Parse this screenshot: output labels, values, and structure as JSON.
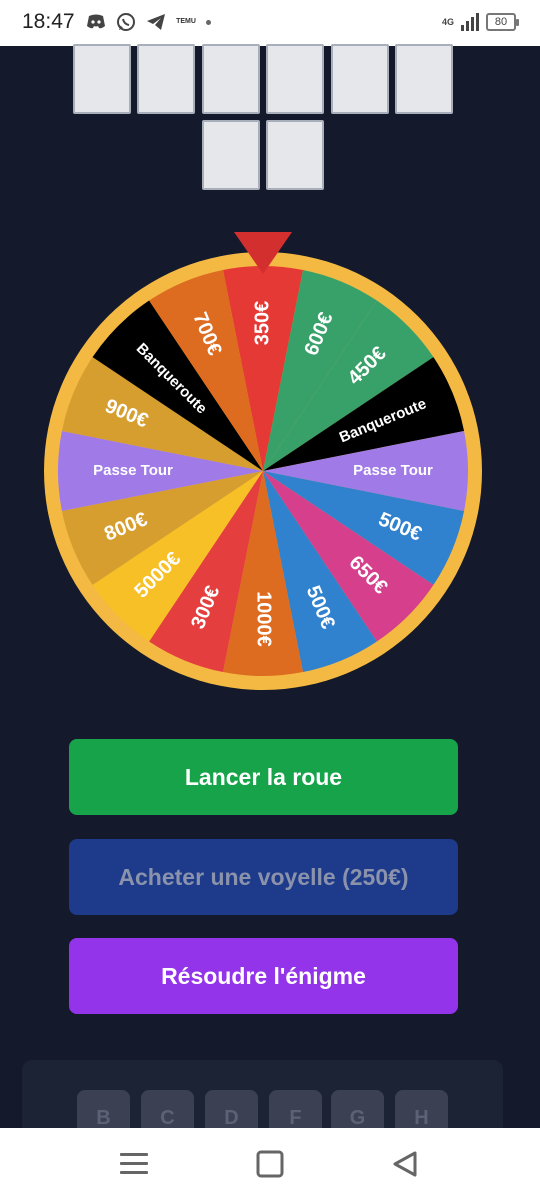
{
  "status_bar": {
    "time": "18:47",
    "temu_label": "TEMU",
    "network": "4G",
    "battery": "80"
  },
  "tiles": {
    "row1_count": 6,
    "row2_count": 2
  },
  "wheel": {
    "pointer_color": "#d32f2f",
    "rim_color": "#f4b942",
    "segments": [
      {
        "label": "350€",
        "color": "#e53935"
      },
      {
        "label": "600€",
        "color": "#38a169"
      },
      {
        "label": "450€",
        "color": "#38a169"
      },
      {
        "label": "Banqueroute",
        "color": "#000000"
      },
      {
        "label": "Passe Tour",
        "color": "#a07be8"
      },
      {
        "label": "500€",
        "color": "#3182ce"
      },
      {
        "label": "650€",
        "color": "#d53f8c"
      },
      {
        "label": "500€",
        "color": "#3182ce"
      },
      {
        "label": "1000€",
        "color": "#dd6b20"
      },
      {
        "label": "300€",
        "color": "#e53e3e"
      },
      {
        "label": "5000€",
        "color": "#f6c026"
      },
      {
        "label": "800€",
        "color": "#d69e2e"
      },
      {
        "label": "Passe Tour",
        "color": "#a07be8"
      },
      {
        "label": "900€",
        "color": "#d69e2e"
      },
      {
        "label": "Banqueroute",
        "color": "#000000"
      },
      {
        "label": "700€",
        "color": "#dd6b20"
      }
    ]
  },
  "buttons": {
    "spin": "Lancer la roue",
    "buy_vowel": "Acheter une voyelle (250€)",
    "solve": "Résoudre l'énigme"
  },
  "keyboard": {
    "keys": [
      "B",
      "C",
      "D",
      "F",
      "G",
      "H"
    ]
  }
}
